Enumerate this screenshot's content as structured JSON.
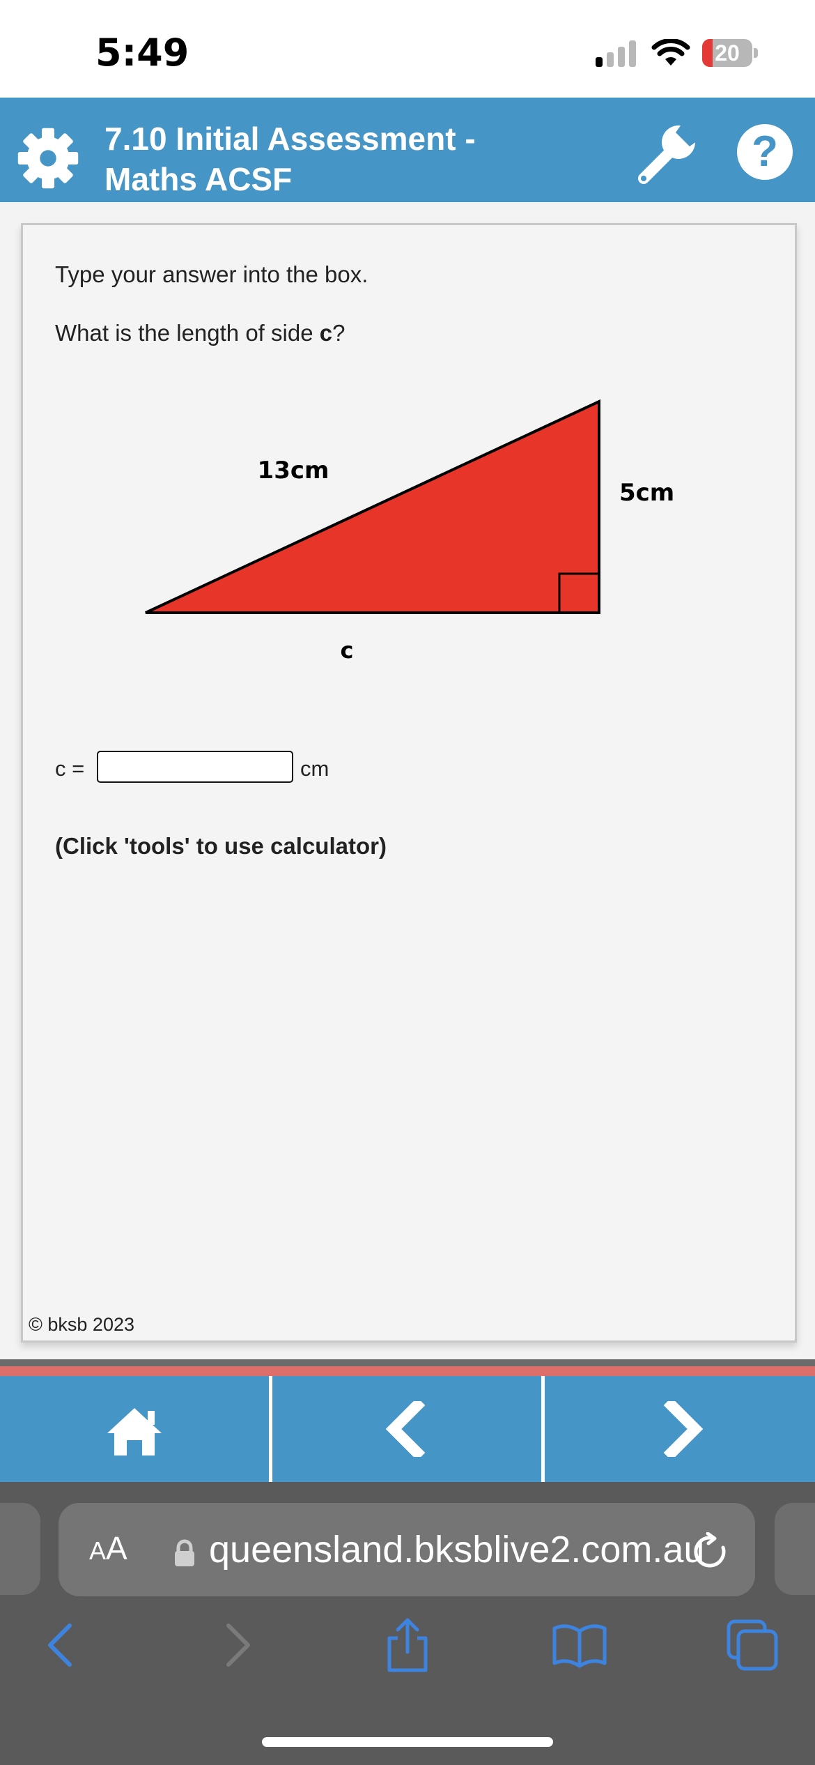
{
  "status_bar": {
    "time": "5:49",
    "battery": "20"
  },
  "header": {
    "title_line1": "7.10 Initial Assessment -",
    "title_line2": "Maths ACSF"
  },
  "question": {
    "instruction": "Type your answer into the box.",
    "prompt_prefix": "What is the length of side ",
    "prompt_var": "c",
    "prompt_suffix": "?",
    "diagram": {
      "hypotenuse_label": "13cm",
      "side_label": "5cm",
      "base_label": "c",
      "fill_color": "#e8352a"
    },
    "answer": {
      "label": "c =",
      "value": "",
      "unit": "cm"
    },
    "hint": "(Click 'tools' to use calculator)"
  },
  "footer": {
    "copyright": "© bksb 2023"
  },
  "safari": {
    "aa_small": "A",
    "aa_large": "A",
    "url": "queensland.bksblive2.com.au"
  },
  "colors": {
    "header_blue": "#4596c6",
    "accent_red": "#dd6e6a",
    "ios_blue": "#3d84e0"
  }
}
